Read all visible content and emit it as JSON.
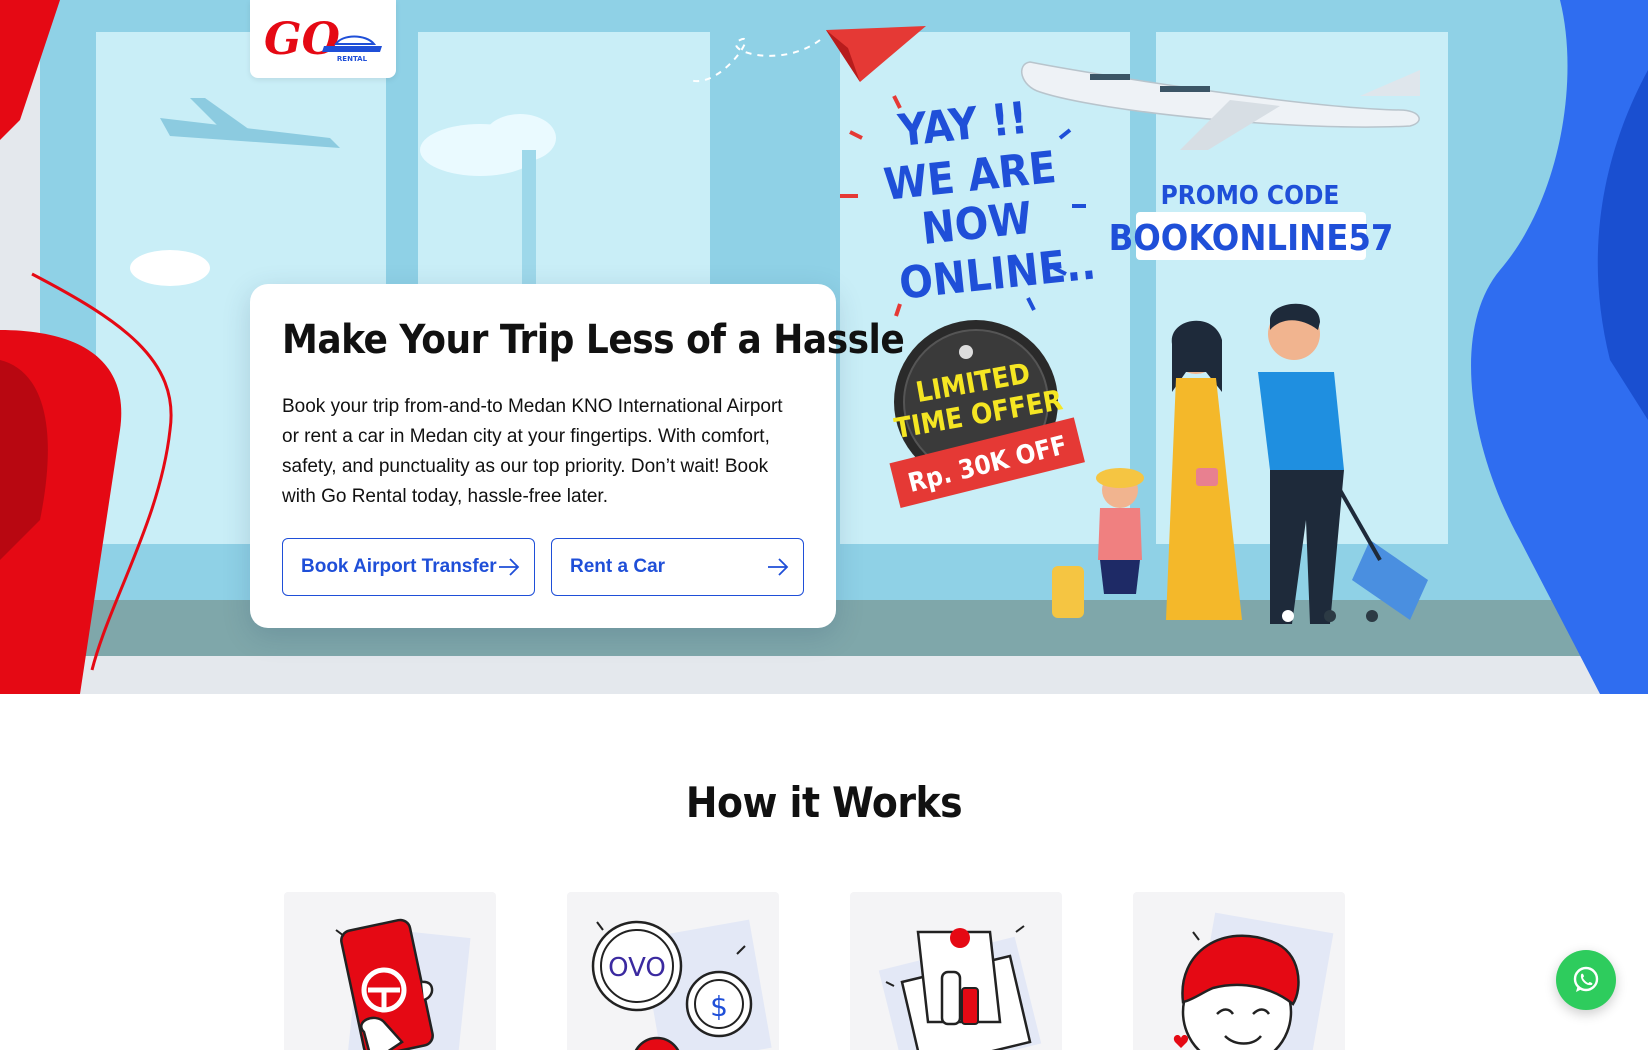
{
  "brand": {
    "logo_text": "GO",
    "logo_sub": "RENTAL"
  },
  "hero": {
    "title": "Make Your Trip Less of a Hassle",
    "description": "Book your trip from-and-to Medan KNO International Airport or rent a car in Medan city at your fingertips. With comfort, safety, and punctuality as our top priority. Don’t wait! Book with Go Rental today, hassle-free later.",
    "buttons": {
      "airport_transfer": "Book Airport Transfer",
      "rent_car": "Rent a Car"
    },
    "banner": {
      "headline_lines": [
        "YAY !!",
        "WE ARE",
        "NOW",
        "ONLINE.."
      ],
      "badge_lines": [
        "LIMITED",
        "TIME OFFER"
      ],
      "badge_ribbon": "Rp. 30K OFF",
      "promo_label": "PROMO CODE",
      "promo_code": "BOOKONLINE57"
    },
    "carousel": {
      "count": 3,
      "active_index": 0
    }
  },
  "how_it_works": {
    "title": "How it Works",
    "steps": [
      {
        "icon": "phone-app-icon"
      },
      {
        "icon": "payment-wallet-icon",
        "label": "OVO"
      },
      {
        "icon": "envelope-key-icon"
      },
      {
        "icon": "happy-face-icon"
      }
    ]
  },
  "colors": {
    "brand_red": "#e50914",
    "brand_blue": "#1f4fd8",
    "whatsapp_green": "#2ecc5d"
  }
}
